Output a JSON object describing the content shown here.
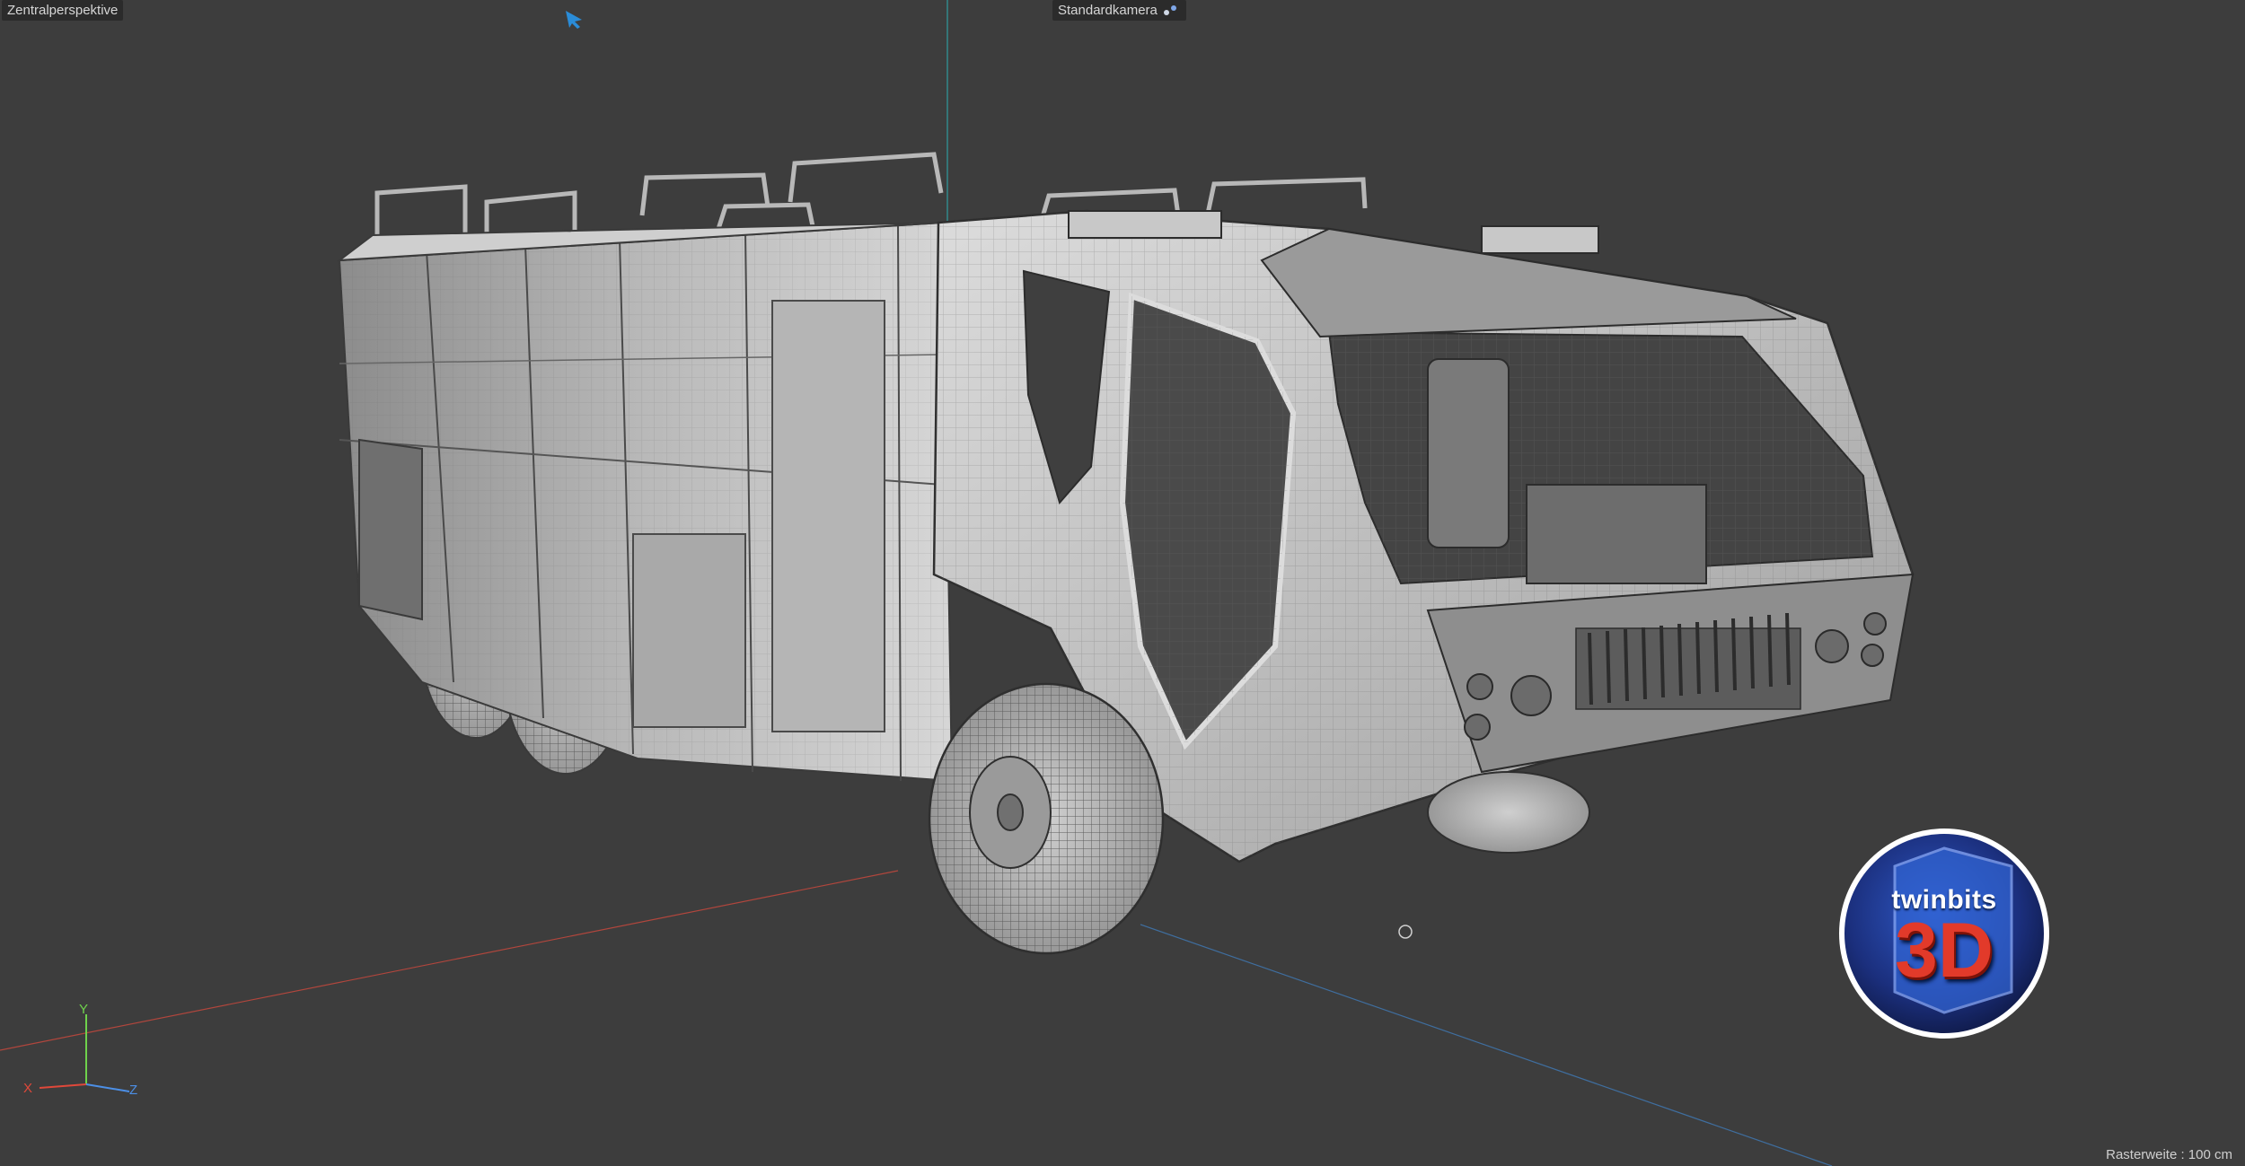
{
  "viewport": {
    "view_mode_label": "Zentralperspektive",
    "camera_label": "Standardkamera",
    "grid_size_label": "Rasterweite : 100 cm"
  },
  "axis_gizmo": {
    "x": "X",
    "y": "Y",
    "z": "Z"
  },
  "logo": {
    "line1": "twinbits",
    "line2": "3D"
  },
  "colors": {
    "background": "#3d3d3d",
    "x_axis": "#e0483a",
    "y_axis": "#6fd24c",
    "z_axis": "#4c8fe6",
    "label_bg": "#2b2b2b"
  },
  "icons": [
    "camera-icon",
    "cursor-arrow-icon",
    "axis-gizmo-icon"
  ]
}
